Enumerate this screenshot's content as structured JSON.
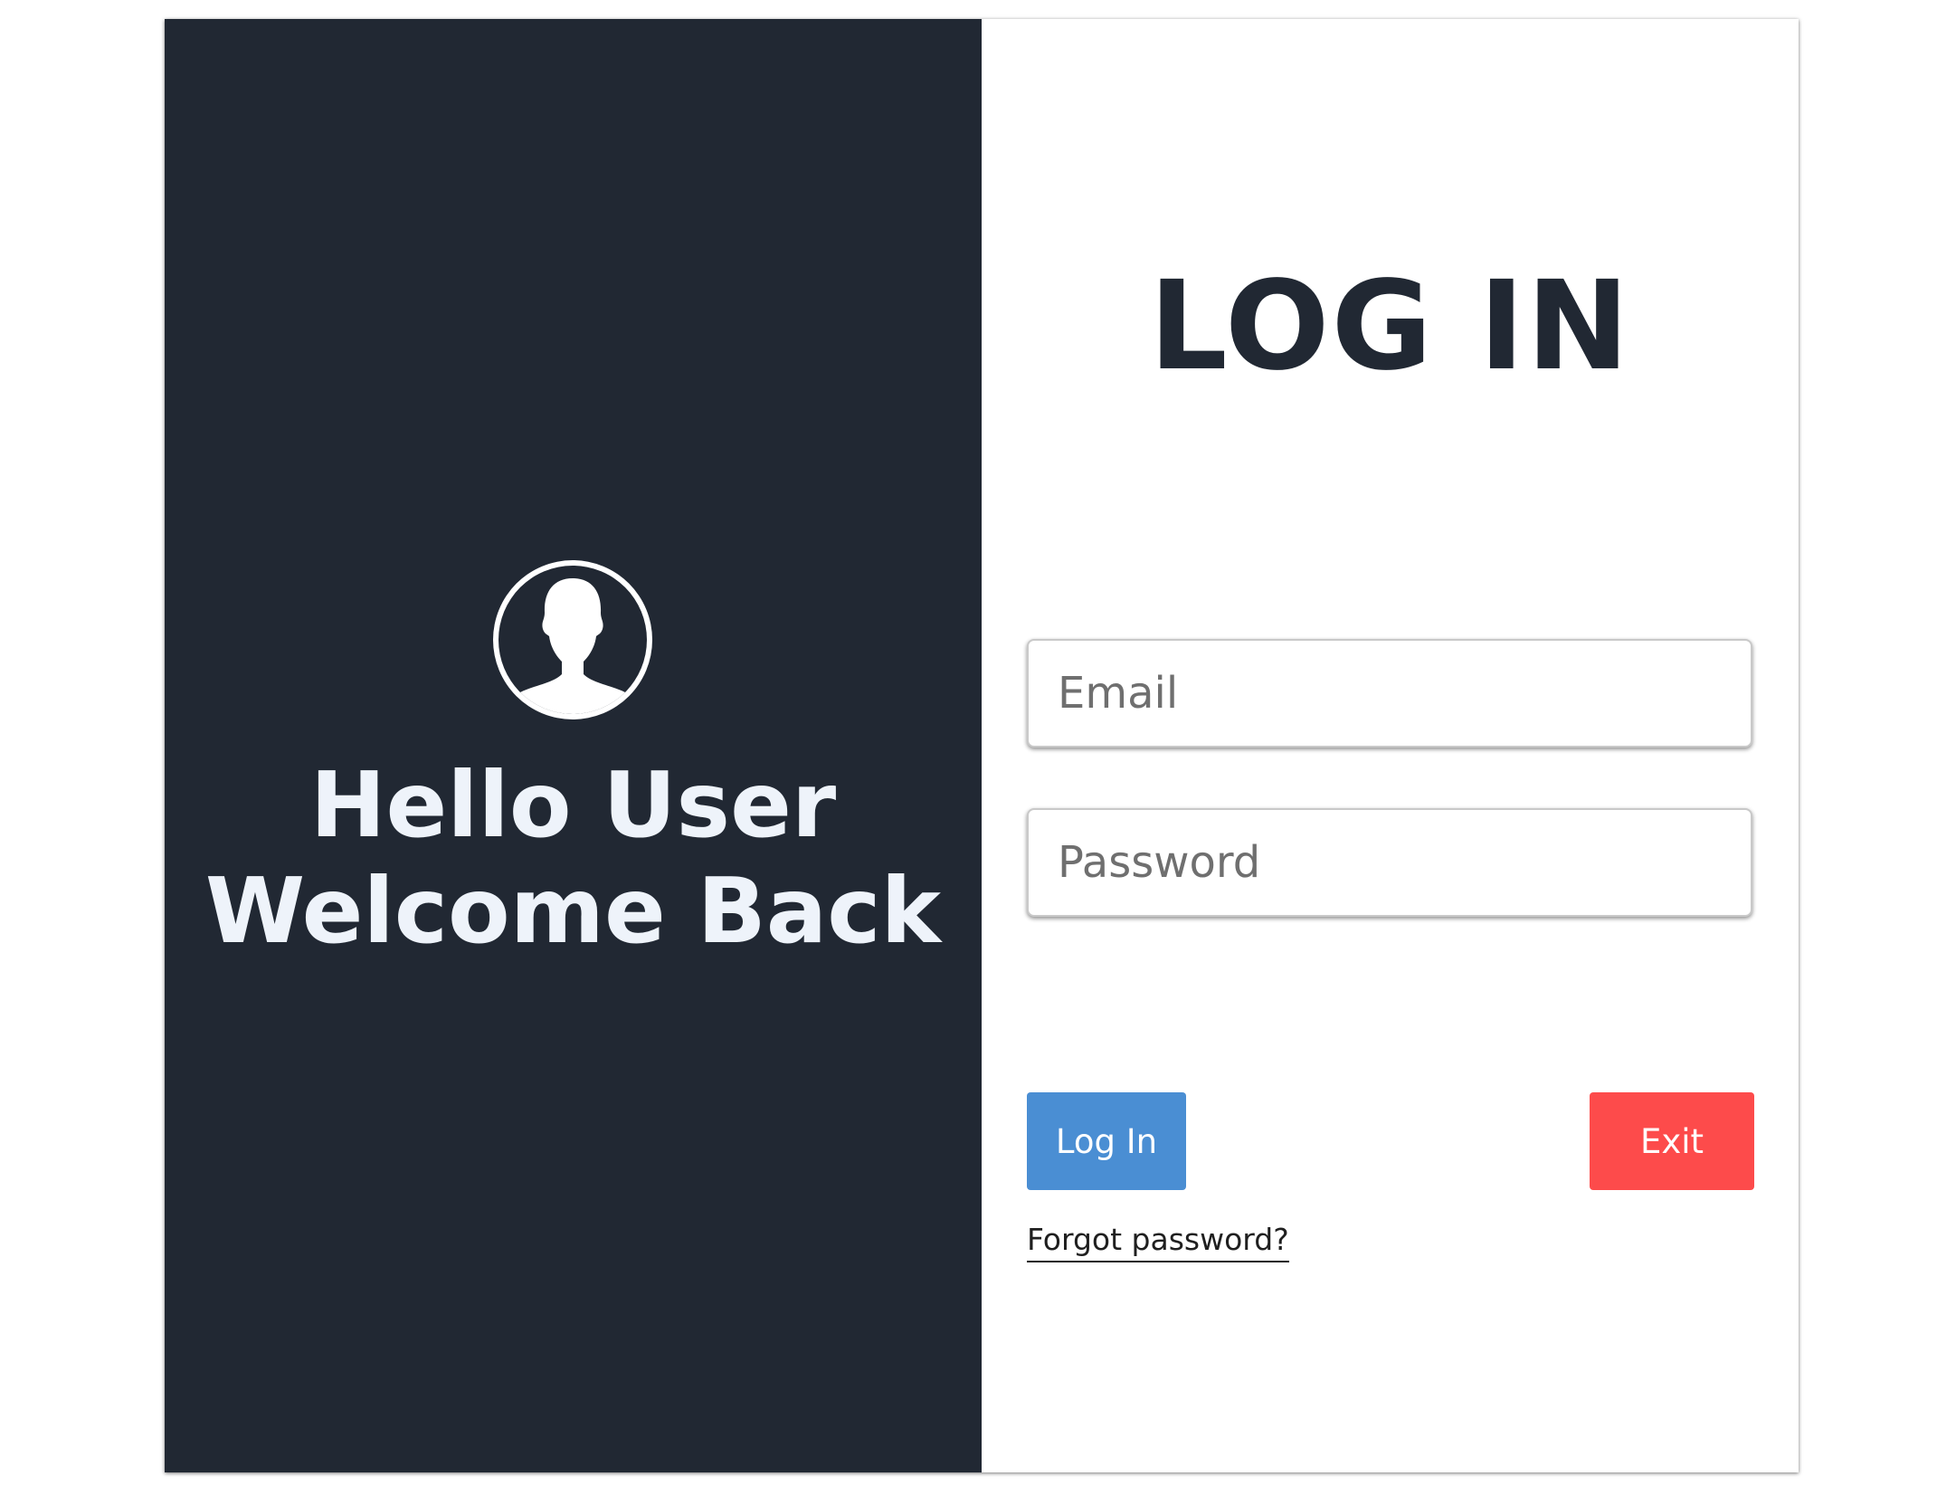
{
  "welcome": {
    "line1": "Hello User",
    "line2": "Welcome Back"
  },
  "login": {
    "title": "LOG IN",
    "email_placeholder": "Email",
    "password_placeholder": "Password",
    "login_label": "Log In",
    "exit_label": "Exit",
    "forgot_label": "Forgot password?"
  },
  "icons": {
    "avatar": "user-silhouette-icon"
  },
  "colors": {
    "panel_dark": "#212833",
    "login_button": "#4a8ed3",
    "exit_button": "#fd4b4b",
    "title_text": "#212833"
  }
}
